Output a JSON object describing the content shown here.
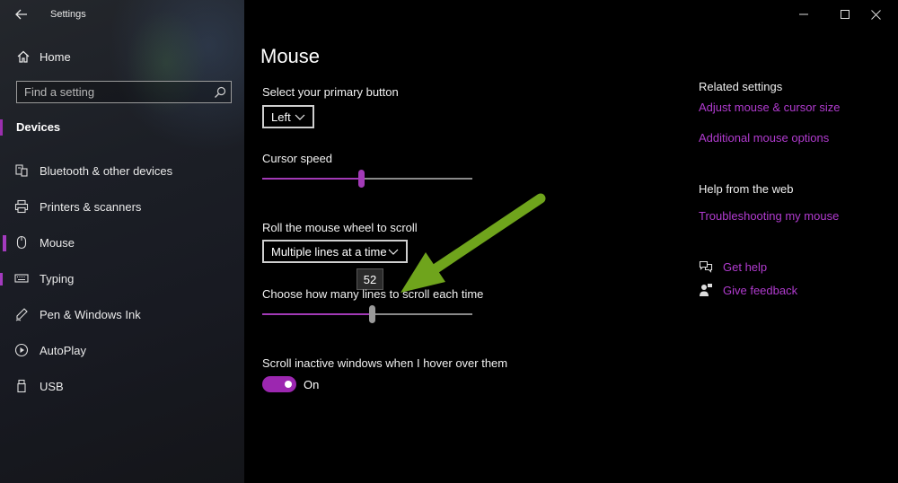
{
  "window": {
    "title": "Settings"
  },
  "sidebar": {
    "home_label": "Home",
    "search_placeholder": "Find a setting",
    "section_title": "Devices",
    "items": [
      {
        "label": "Bluetooth & other devices",
        "icon": "bluetooth-devices-icon",
        "selected": false
      },
      {
        "label": "Printers & scanners",
        "icon": "printer-icon",
        "selected": false
      },
      {
        "label": "Mouse",
        "icon": "mouse-icon",
        "selected": true
      },
      {
        "label": "Typing",
        "icon": "keyboard-icon",
        "selected": false
      },
      {
        "label": "Pen & Windows Ink",
        "icon": "pen-icon",
        "selected": false
      },
      {
        "label": "AutoPlay",
        "icon": "autoplay-icon",
        "selected": false
      },
      {
        "label": "USB",
        "icon": "usb-icon",
        "selected": false
      }
    ]
  },
  "main": {
    "page_title": "Mouse",
    "primary_button": {
      "label": "Select your primary button",
      "value": "Left"
    },
    "cursor_speed": {
      "label": "Cursor speed",
      "value_fraction": 0.47
    },
    "wheel_scroll": {
      "label": "Roll the mouse wheel to scroll",
      "value": "Multiple lines at a time"
    },
    "lines_to_scroll": {
      "label": "Choose how many lines to scroll each time",
      "tooltip": "52",
      "value_fraction": 0.52
    },
    "inactive_scroll": {
      "label": "Scroll inactive windows when I hover over them",
      "state": "On",
      "enabled": true
    }
  },
  "related": {
    "heading": "Related settings",
    "links": [
      "Adjust mouse & cursor size",
      "Additional mouse options"
    ]
  },
  "help_web": {
    "heading": "Help from the web",
    "links": [
      "Troubleshooting my mouse"
    ]
  },
  "support": {
    "get_help": "Get help",
    "give_feedback": "Give feedback"
  },
  "colors": {
    "accent": "#a23ab7",
    "link": "#b13bcf",
    "annotation_arrow": "#6fa41c"
  }
}
